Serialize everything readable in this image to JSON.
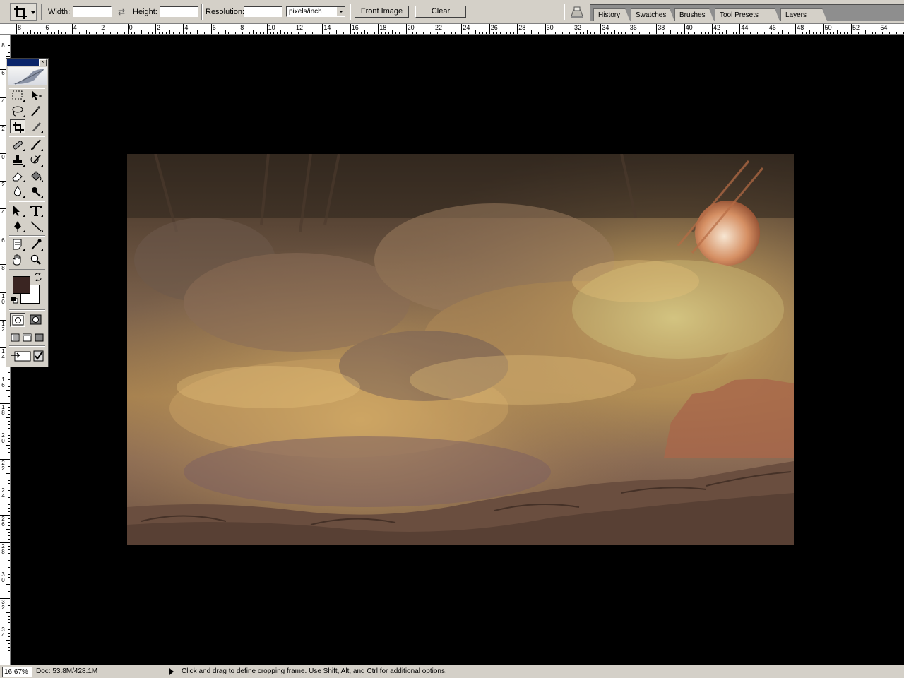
{
  "options_bar": {
    "width_label": "Width:",
    "width_value": "",
    "height_label": "Height:",
    "height_value": "",
    "resolution_label": "Resolution:",
    "resolution_value": "",
    "resolution_unit": "pixels/inch",
    "front_image_button": "Front Image",
    "clear_button": "Clear"
  },
  "palette_tabs": [
    "History",
    "Swatches",
    "Brushes",
    "Tool Presets",
    "Layers"
  ],
  "ruler": {
    "horizontal_labels": [
      "8",
      "6",
      "4",
      "2",
      "0",
      "2",
      "4",
      "6",
      "8",
      "10",
      "12",
      "14",
      "16",
      "18",
      "20",
      "22",
      "24",
      "26",
      "28",
      "30",
      "32",
      "34",
      "36",
      "38",
      "40",
      "42",
      "44",
      "46",
      "48",
      "50",
      "52",
      "54"
    ],
    "vertical_labels": [
      "8",
      "6",
      "4",
      "2",
      "0",
      "2",
      "4",
      "6",
      "8",
      "10",
      "12",
      "14",
      "16",
      "18",
      "20",
      "22",
      "24",
      "26",
      "28",
      "30",
      "32",
      "34"
    ]
  },
  "colors": {
    "foreground": "#3a2522",
    "background": "#ffffff",
    "titlebar": "#0a246a"
  },
  "toolbox_icons": [
    "rectangular-marquee-icon",
    "move-icon",
    "lasso-icon",
    "magic-wand-icon",
    "crop-icon",
    "slice-icon",
    "healing-brush-icon",
    "brush-icon",
    "clone-stamp-icon",
    "history-brush-icon",
    "eraser-icon",
    "paint-bucket-icon",
    "blur-icon",
    "dodge-icon",
    "path-selection-icon",
    "type-icon",
    "pen-icon",
    "line-icon",
    "notes-icon",
    "eyedropper-icon",
    "hand-icon",
    "zoom-icon"
  ],
  "status_bar": {
    "zoom": "16.67%",
    "doc_info": "Doc: 53.8M/428.1M",
    "message": "Click and drag to define cropping frame. Use Shift, Alt, and Ctrl for additional options."
  }
}
